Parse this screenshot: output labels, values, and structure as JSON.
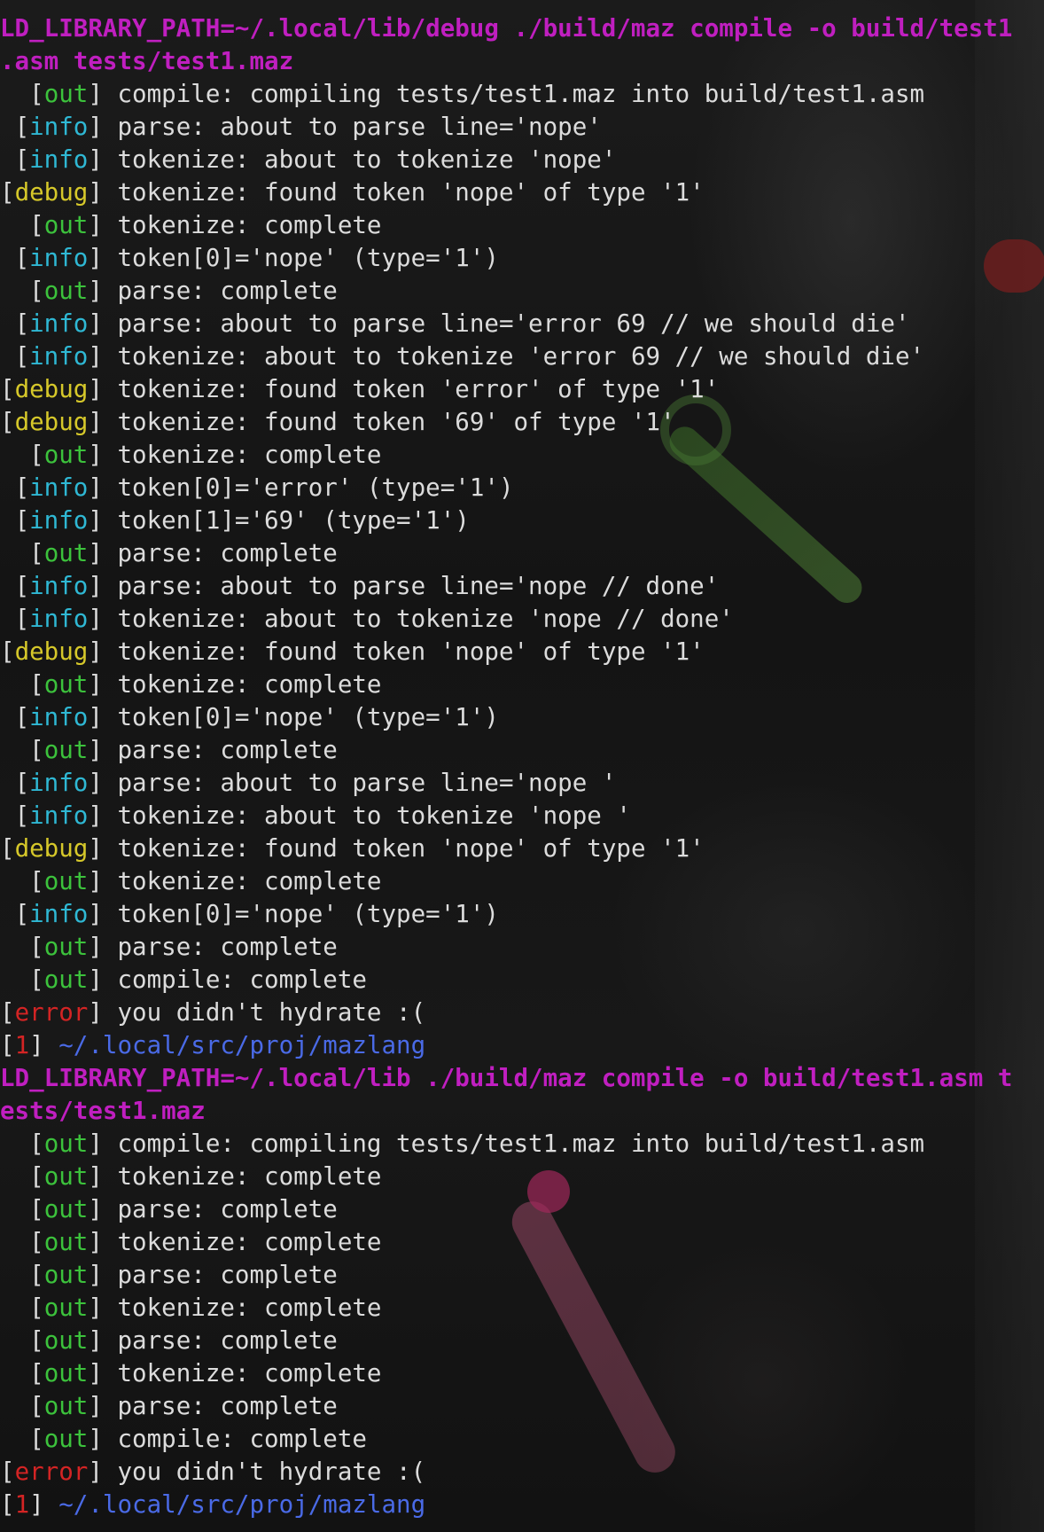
{
  "colors": {
    "background": "#161616",
    "text": "#dcdcdc",
    "command": "#c01fc0",
    "out": "#3cc23c",
    "info": "#2fb8d4",
    "debug": "#d6c82a",
    "error": "#d42424",
    "path": "#4a6ae6"
  },
  "lines": [
    {
      "type": "cmd",
      "text": "LD_LIBRARY_PATH=~/.local/lib/debug ./build/maz compile -o build/test1"
    },
    {
      "type": "cmd",
      "text": ".asm tests/test1.maz"
    },
    {
      "type": "log",
      "pad": "  ",
      "level": "out",
      "msg": " compile: compiling tests/test1.maz into build/test1.asm"
    },
    {
      "type": "log",
      "pad": " ",
      "level": "info",
      "msg": " parse: about to parse line='nope'"
    },
    {
      "type": "log",
      "pad": " ",
      "level": "info",
      "msg": " tokenize: about to tokenize 'nope'"
    },
    {
      "type": "log",
      "pad": "",
      "level": "debug",
      "msg": " tokenize: found token 'nope' of type '1'"
    },
    {
      "type": "log",
      "pad": "  ",
      "level": "out",
      "msg": " tokenize: complete"
    },
    {
      "type": "log",
      "pad": " ",
      "level": "info",
      "msg": " token[0]='nope' (type='1')"
    },
    {
      "type": "log",
      "pad": "  ",
      "level": "out",
      "msg": " parse: complete"
    },
    {
      "type": "log",
      "pad": " ",
      "level": "info",
      "msg": " parse: about to parse line='error 69 // we should die'"
    },
    {
      "type": "log",
      "pad": " ",
      "level": "info",
      "msg": " tokenize: about to tokenize 'error 69 // we should die'"
    },
    {
      "type": "log",
      "pad": "",
      "level": "debug",
      "msg": " tokenize: found token 'error' of type '1'"
    },
    {
      "type": "log",
      "pad": "",
      "level": "debug",
      "msg": " tokenize: found token '69' of type '1'"
    },
    {
      "type": "log",
      "pad": "  ",
      "level": "out",
      "msg": " tokenize: complete"
    },
    {
      "type": "log",
      "pad": " ",
      "level": "info",
      "msg": " token[0]='error' (type='1')"
    },
    {
      "type": "log",
      "pad": " ",
      "level": "info",
      "msg": " token[1]='69' (type='1')"
    },
    {
      "type": "log",
      "pad": "  ",
      "level": "out",
      "msg": " parse: complete"
    },
    {
      "type": "log",
      "pad": " ",
      "level": "info",
      "msg": " parse: about to parse line='nope // done'"
    },
    {
      "type": "log",
      "pad": " ",
      "level": "info",
      "msg": " tokenize: about to tokenize 'nope // done'"
    },
    {
      "type": "log",
      "pad": "",
      "level": "debug",
      "msg": " tokenize: found token 'nope' of type '1'"
    },
    {
      "type": "log",
      "pad": "  ",
      "level": "out",
      "msg": " tokenize: complete"
    },
    {
      "type": "log",
      "pad": " ",
      "level": "info",
      "msg": " token[0]='nope' (type='1')"
    },
    {
      "type": "log",
      "pad": "  ",
      "level": "out",
      "msg": " parse: complete"
    },
    {
      "type": "log",
      "pad": " ",
      "level": "info",
      "msg": " parse: about to parse line='nope '"
    },
    {
      "type": "log",
      "pad": " ",
      "level": "info",
      "msg": " tokenize: about to tokenize 'nope '"
    },
    {
      "type": "log",
      "pad": "",
      "level": "debug",
      "msg": " tokenize: found token 'nope' of type '1'"
    },
    {
      "type": "log",
      "pad": "  ",
      "level": "out",
      "msg": " tokenize: complete"
    },
    {
      "type": "log",
      "pad": " ",
      "level": "info",
      "msg": " token[0]='nope' (type='1')"
    },
    {
      "type": "log",
      "pad": "  ",
      "level": "out",
      "msg": " parse: complete"
    },
    {
      "type": "log",
      "pad": "  ",
      "level": "out",
      "msg": " compile: complete"
    },
    {
      "type": "log",
      "pad": "",
      "level": "error",
      "msg": " you didn't hydrate :("
    },
    {
      "type": "prompt",
      "code": "1",
      "path": "~/.local/src/proj/mazlang"
    },
    {
      "type": "cmd",
      "text": "LD_LIBRARY_PATH=~/.local/lib ./build/maz compile -o build/test1.asm t"
    },
    {
      "type": "cmd",
      "text": "ests/test1.maz"
    },
    {
      "type": "log",
      "pad": "  ",
      "level": "out",
      "msg": " compile: compiling tests/test1.maz into build/test1.asm"
    },
    {
      "type": "log",
      "pad": "  ",
      "level": "out",
      "msg": " tokenize: complete"
    },
    {
      "type": "log",
      "pad": "  ",
      "level": "out",
      "msg": " parse: complete"
    },
    {
      "type": "log",
      "pad": "  ",
      "level": "out",
      "msg": " tokenize: complete"
    },
    {
      "type": "log",
      "pad": "  ",
      "level": "out",
      "msg": " parse: complete"
    },
    {
      "type": "log",
      "pad": "  ",
      "level": "out",
      "msg": " tokenize: complete"
    },
    {
      "type": "log",
      "pad": "  ",
      "level": "out",
      "msg": " parse: complete"
    },
    {
      "type": "log",
      "pad": "  ",
      "level": "out",
      "msg": " tokenize: complete"
    },
    {
      "type": "log",
      "pad": "  ",
      "level": "out",
      "msg": " parse: complete"
    },
    {
      "type": "log",
      "pad": "  ",
      "level": "out",
      "msg": " compile: complete"
    },
    {
      "type": "log",
      "pad": "",
      "level": "error",
      "msg": " you didn't hydrate :("
    },
    {
      "type": "prompt",
      "code": "1",
      "path": "~/.local/src/proj/mazlang"
    }
  ]
}
